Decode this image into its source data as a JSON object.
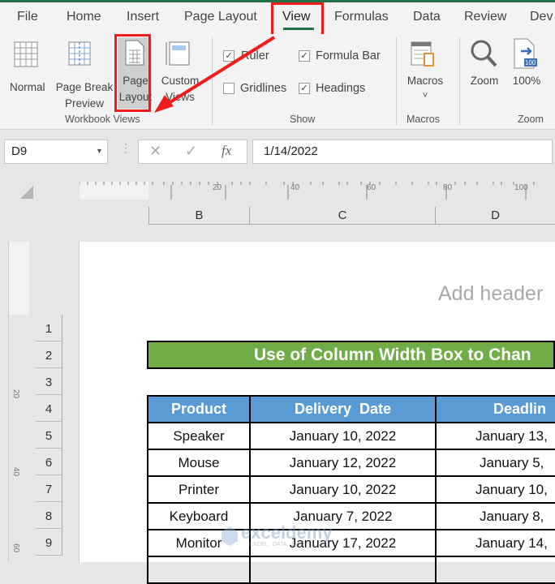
{
  "tabs": [
    "File",
    "Home",
    "Insert",
    "Page Layout",
    "View",
    "Formulas",
    "Data",
    "Review",
    "Dev"
  ],
  "ribbon": {
    "workbook_views": {
      "label": "Workbook Views",
      "normal": "Normal",
      "page_break_1": "Page Break",
      "page_break_2": "Preview",
      "page_layout_1": "Page",
      "page_layout_2": "Layout",
      "custom_1": "Custom",
      "custom_2": "Views"
    },
    "show": {
      "label": "Show",
      "ruler": "Ruler",
      "formula_bar": "Formula Bar",
      "gridlines": "Gridlines",
      "headings": "Headings",
      "ruler_checked": true,
      "formula_bar_checked": true,
      "gridlines_checked": false,
      "headings_checked": true,
      "check": "✓"
    },
    "macros": {
      "label": "Macros",
      "button": "Macros",
      "chevron": "˅"
    },
    "zoom": {
      "label": "Zoom",
      "zoom": "Zoom",
      "hundred": "100%",
      "badge": "100"
    }
  },
  "formula_bar": {
    "name_box": "D9",
    "value": "1/14/2022",
    "fx": "fx",
    "cancel": "✕",
    "enter": "✓"
  },
  "ruler": {
    "ticks": [
      "20",
      "40",
      "60",
      "80",
      "100"
    ],
    "vticks": [
      "20",
      "40",
      "60"
    ]
  },
  "columns": [
    "B",
    "C",
    "D"
  ],
  "rows": [
    "1",
    "2",
    "3",
    "4",
    "5",
    "6",
    "7",
    "8",
    "9"
  ],
  "page": {
    "header_placeholder": "Add header"
  },
  "sheet": {
    "title": "Use of Column Width Box to Chan",
    "headers": [
      "Product",
      "Delivery  Date",
      "Deadlin"
    ],
    "data": [
      [
        "Speaker",
        "January 10, 2022",
        "January 13,"
      ],
      [
        "Mouse",
        "January 12, 2022",
        "January 5,"
      ],
      [
        "Printer",
        "January 10, 2022",
        "January 10,"
      ],
      [
        "Keyboard",
        "January 7, 2022",
        "January 8,"
      ],
      [
        "Monitor",
        "January 17, 2022",
        "January 14,"
      ]
    ]
  },
  "watermark": {
    "brand": "exceldemy",
    "sub": "EXCEL · DATA · BI"
  },
  "colors": {
    "accent": "#217346",
    "highlight": "#f01c1c",
    "title_bg": "#70ad47",
    "header_bg": "#5b9bd5"
  }
}
